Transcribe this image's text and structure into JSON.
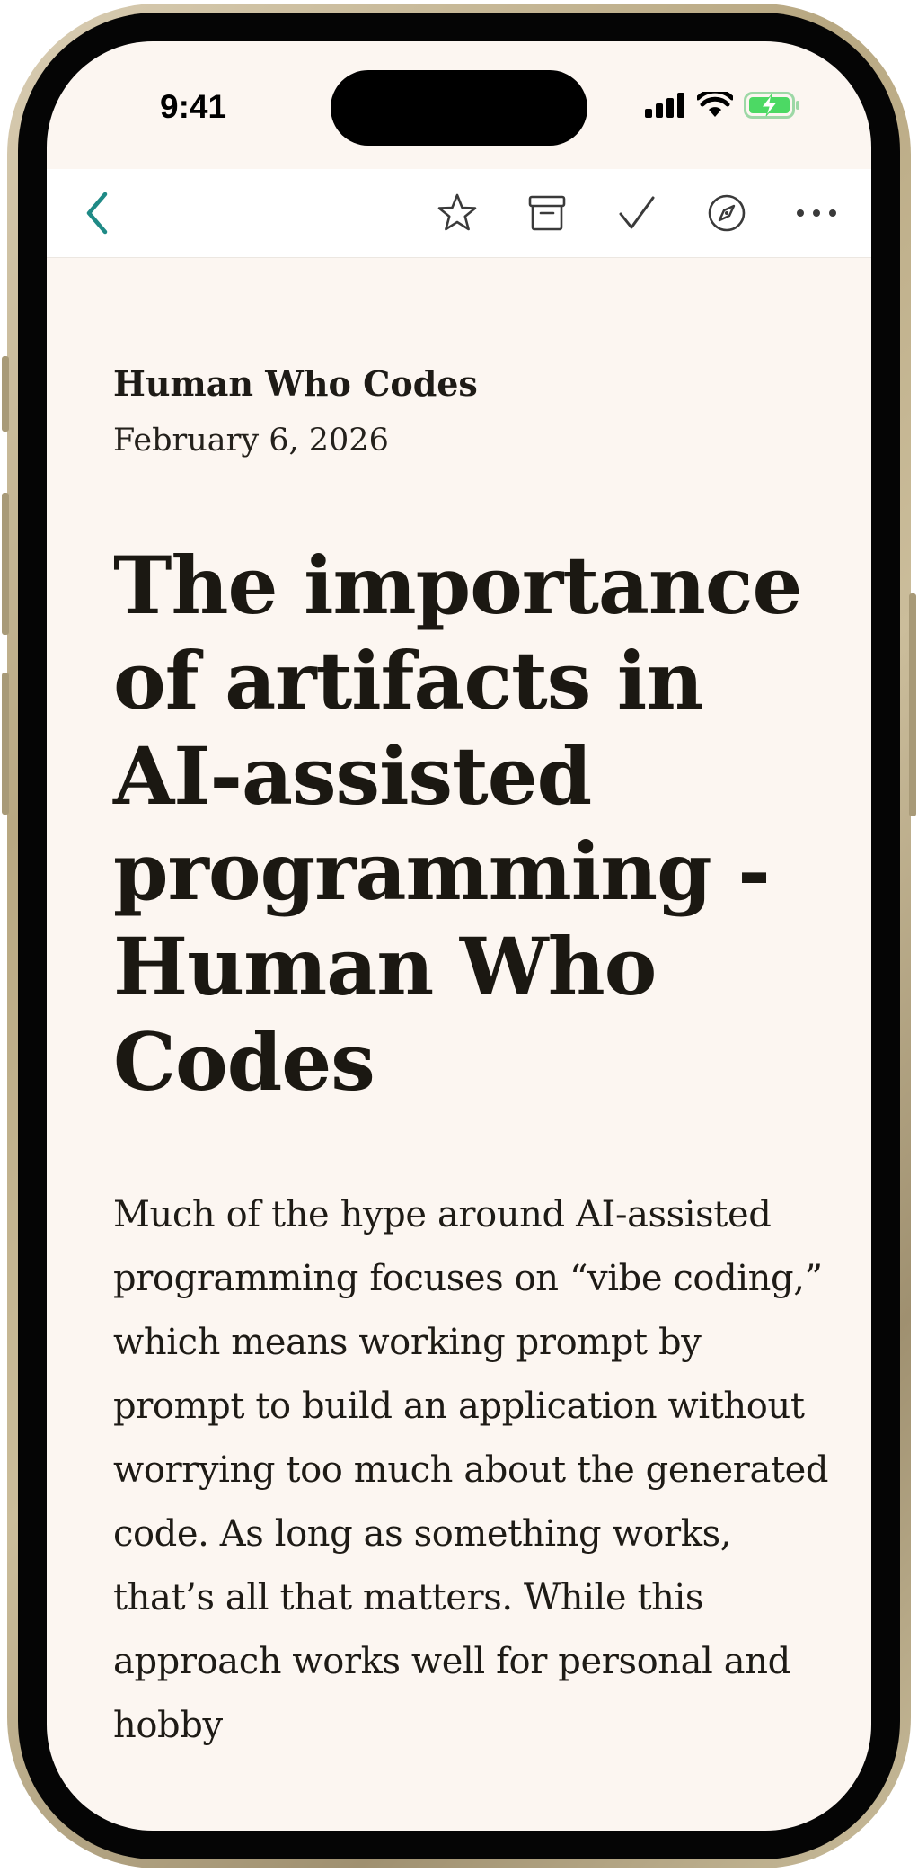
{
  "status_bar": {
    "time": "9:41"
  },
  "toolbar": {
    "back_icon": "chevron-left-icon",
    "actions": [
      "star-icon",
      "archive-icon",
      "checkmark-icon",
      "compass-icon",
      "more-icon"
    ]
  },
  "article": {
    "site_name": "Human Who Codes",
    "date": "February 6, 2026",
    "title": "The importance of artifacts in AI-assisted programming - Human Who Codes",
    "body": "Much of the hype around AI-assisted programming focuses on “vibe coding,” which means working prompt by prompt to build an application without worrying too much about the generated code. As long as something works, that’s all that matters. While this approach works well for personal and hobby"
  },
  "colors": {
    "accent": "#1f8a86",
    "page_background": "#fcf6f1",
    "toolbar_background": "#ffffff",
    "text": "#1e1b16",
    "battery": "#4cd964"
  }
}
